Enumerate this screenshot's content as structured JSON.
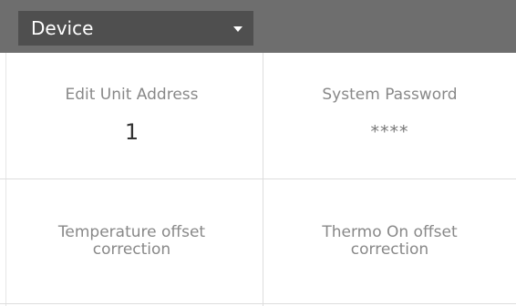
{
  "header": {
    "dropdown_label": "Device",
    "dropdown_icon": "caret-down-icon"
  },
  "grid": {
    "cells": [
      {
        "title": "Edit Unit Address",
        "value": "1"
      },
      {
        "title": "System Password",
        "value": "****"
      },
      {
        "title_line1": "Temperature offset",
        "title_line2": "correction"
      },
      {
        "title_line1": "Thermo On offset",
        "title_line2": "correction"
      }
    ]
  },
  "colors": {
    "header_bg": "#6e6e6e",
    "dropdown_bg": "#4f4f4f",
    "label_text": "#888888",
    "value_text": "#333333",
    "divider": "#dddddd"
  }
}
